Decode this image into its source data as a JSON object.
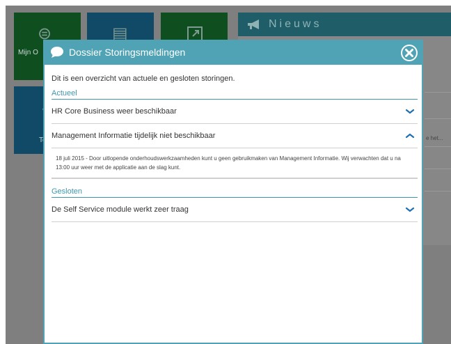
{
  "background": {
    "tiles": [
      {
        "label": "Mijn O"
      },
      {
        "label": ""
      },
      {
        "label": ""
      },
      {
        "label": "Te"
      }
    ],
    "news": {
      "title": "Nieuws",
      "side_text": "e het..."
    }
  },
  "modal": {
    "title": "Dossier Storingsmeldingen",
    "intro": "Dit is een overzicht van actuele en gesloten storingen.",
    "sections": [
      {
        "title": "Actueel",
        "items": [
          {
            "label": "HR Core Business weer beschikbaar",
            "state": "collapsed"
          },
          {
            "label": "Management Informatie tijdelijk niet beschikbaar",
            "state": "expanded",
            "detail": "18 juli 2015 - Door uitlopende onderhoudswerkzaamheden kunt u geen gebruikmaken van Management Informatie. Wij verwachten dat u na 13:00 uur weer met de applicatie aan de slag kunt."
          }
        ]
      },
      {
        "title": "Gesloten",
        "items": [
          {
            "label": "De Self Service module werkt zeer traag",
            "state": "collapsed"
          }
        ]
      }
    ]
  },
  "colors": {
    "accent": "#4fa3b4",
    "section_title": "#3f97ad",
    "chevron": "#1e6fb2",
    "overlay": "#7f7f7f"
  },
  "icons": [
    "chat-bubble-icon",
    "close-icon",
    "chevron-down-icon",
    "chevron-up-icon",
    "megaphone-icon"
  ]
}
